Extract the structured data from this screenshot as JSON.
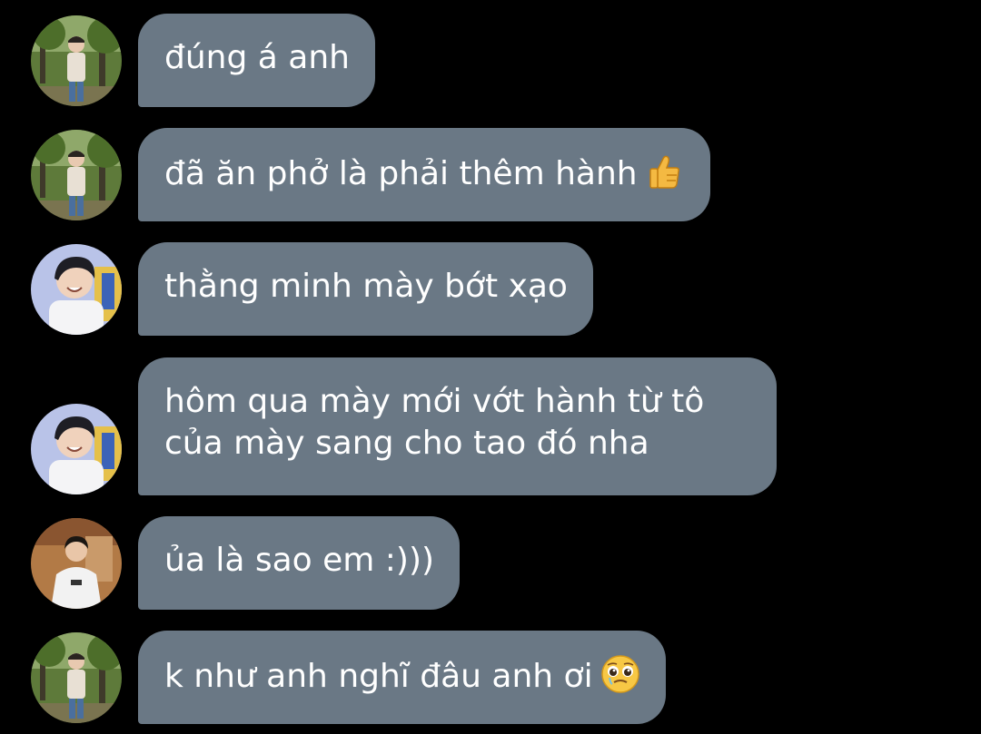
{
  "conversation": {
    "messages": [
      {
        "avatar": "avatar-person-park",
        "text": "đúng á anh"
      },
      {
        "avatar": "avatar-person-park",
        "text": "đã ăn phở là phải thêm hành",
        "emoji": "thumbs-up-icon"
      },
      {
        "avatar": "avatar-person-smiling",
        "text": "thằng minh mày bớt xạo"
      },
      {
        "avatar": "avatar-person-smiling",
        "lines": [
          "hôm qua mày mới vớt hành từ tô",
          "của mày sang cho tao đó nha"
        ]
      },
      {
        "avatar": "avatar-person-indoor",
        "text": "ủa là sao em :)))"
      },
      {
        "avatar": "avatar-person-park",
        "text": "k như anh nghĩ đâu anh ơi",
        "emoji": "pleading-face-icon"
      }
    ]
  },
  "colors": {
    "background": "#000000",
    "bubble": "#6a7885",
    "text": "#ffffff"
  }
}
